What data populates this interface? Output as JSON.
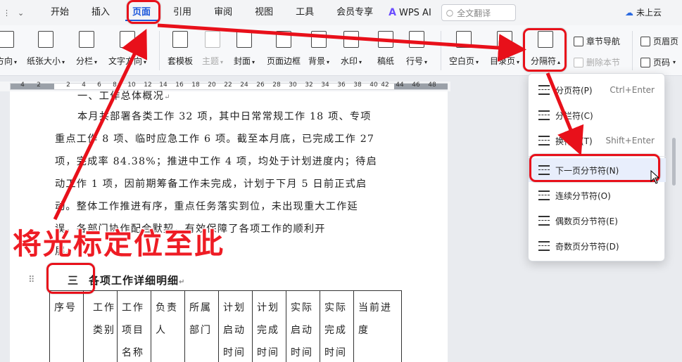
{
  "menubar": {
    "tabs": [
      "开始",
      "插入",
      "页面",
      "引用",
      "审阅",
      "视图",
      "工具",
      "会员专享"
    ],
    "active_tab": "页面",
    "wps_ai_label": "WPS AI",
    "search_placeholder": "全文翻译",
    "cloud_label": "未上云"
  },
  "ribbon": {
    "direction_label": "方向",
    "paper_size_label": "纸张大小",
    "columns_label": "分栏",
    "text_dir_label": "文字方向",
    "template_label": "套模板",
    "theme_label": "主题",
    "cover_label": "封面",
    "page_border_label": "页面边框",
    "background_label": "背景",
    "watermark_label": "水印",
    "manuscript_label": "稿纸",
    "line_num_label": "行号",
    "blank_page_label": "空白页",
    "toc_page_label": "目录页",
    "break_label": "分隔符",
    "section_nav_label": "章节导航",
    "delete_section_label": "删除本节",
    "header_footer_label": "页眉页",
    "page_num_label": "页码"
  },
  "ruler": {
    "ticks": [
      "4",
      "2",
      "2",
      "4",
      "6",
      "8",
      "10",
      "12",
      "14",
      "16",
      "18",
      "20",
      "22",
      "24",
      "26",
      "28",
      "30",
      "32",
      "34",
      "36",
      "38",
      "40",
      "42",
      "44",
      "46",
      "48"
    ]
  },
  "document": {
    "section_heading_partial": "一、工作总体概况",
    "paragraph_lines": [
      "本月共部署各类工作 32 项，其中日常常规工作 18 项、专项",
      "重点工作 8 项、临时应急工作 6 项。截至本月底，已完成工作 27",
      "项，完成率 84.38%；推进中工作 4 项，均处于计划进度内；待启",
      "动工作 1 项，因前期筹备工作未完成，计划于下月 5 日前正式启",
      "动。整体工作推进有序，重点任务落实到位，未出现重大工作延",
      "误，各部门协作配合默契，有效保障了各项工作的顺利开",
      "展。"
    ],
    "heading3_num": "三",
    "heading3_text": "各项工作详细明细",
    "table_headers": [
      [
        "序号"
      ],
      [
        "工作",
        "类别"
      ],
      [
        "工作",
        "项目",
        "名称"
      ],
      [
        "负责",
        "人"
      ],
      [
        "所属",
        "部门"
      ],
      [
        "计划",
        "启动",
        "时间"
      ],
      [
        "计划",
        "完成",
        "时间"
      ],
      [
        "实际",
        "启动",
        "时间"
      ],
      [
        "实际",
        "完成",
        "时间"
      ],
      [
        "当前进",
        "度"
      ]
    ]
  },
  "dropdown": {
    "items": [
      {
        "label": "分页符(P)",
        "shortcut": "Ctrl+Enter"
      },
      {
        "label": "分栏符(C)",
        "shortcut": ""
      },
      {
        "label": "换行符(T)",
        "shortcut": "Shift+Enter"
      },
      {
        "label": "下一页分节符(N)",
        "shortcut": ""
      },
      {
        "label": "连续分节符(O)",
        "shortcut": ""
      },
      {
        "label": "偶数页分节符(E)",
        "shortcut": ""
      },
      {
        "label": "奇数页分节符(D)",
        "shortcut": ""
      }
    ],
    "highlighted_index": 3
  },
  "annotation": {
    "callout_text": "将光标定位至此",
    "accent_color": "#e8101a"
  }
}
